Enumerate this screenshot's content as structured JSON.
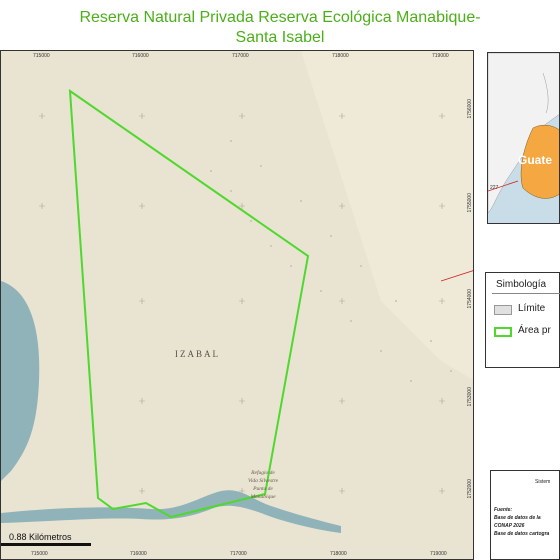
{
  "title": {
    "line1": "Reserva Natural Privada Reserva Ecológica Manabique-",
    "line2": "Santa Isabel"
  },
  "map": {
    "region_label": "IZABAL",
    "refuge_lines": [
      "Refugio de",
      "Vida Silvestre",
      "Punta de",
      "Manabique"
    ],
    "x_ticks_top": [
      "715000",
      "716000",
      "717000",
      "718000",
      "719000"
    ],
    "x_ticks_bottom": [
      "715000",
      "716000",
      "717000",
      "718000",
      "719000"
    ],
    "y_ticks_right": [
      "1756000",
      "1755000",
      "1754000",
      "1753000",
      "1752000"
    ],
    "scale_label": "0.88 Kilómetros",
    "colors": {
      "land": "#e9e3d2",
      "water": "#8fb3b8",
      "boundary": "#4fd82e"
    }
  },
  "inset": {
    "tick": "227",
    "label": "Guate"
  },
  "legend": {
    "title": "Simbología",
    "items": [
      {
        "label": "Límite",
        "color": "#e0e0e0"
      },
      {
        "label": "Área pr",
        "color": "#4fd82e"
      }
    ]
  },
  "info": {
    "system": "Sistem",
    "source_label": "Fuente:",
    "lines": [
      "Base de datos de la",
      "CONAP 2026",
      "Base de datos cartogra"
    ]
  }
}
